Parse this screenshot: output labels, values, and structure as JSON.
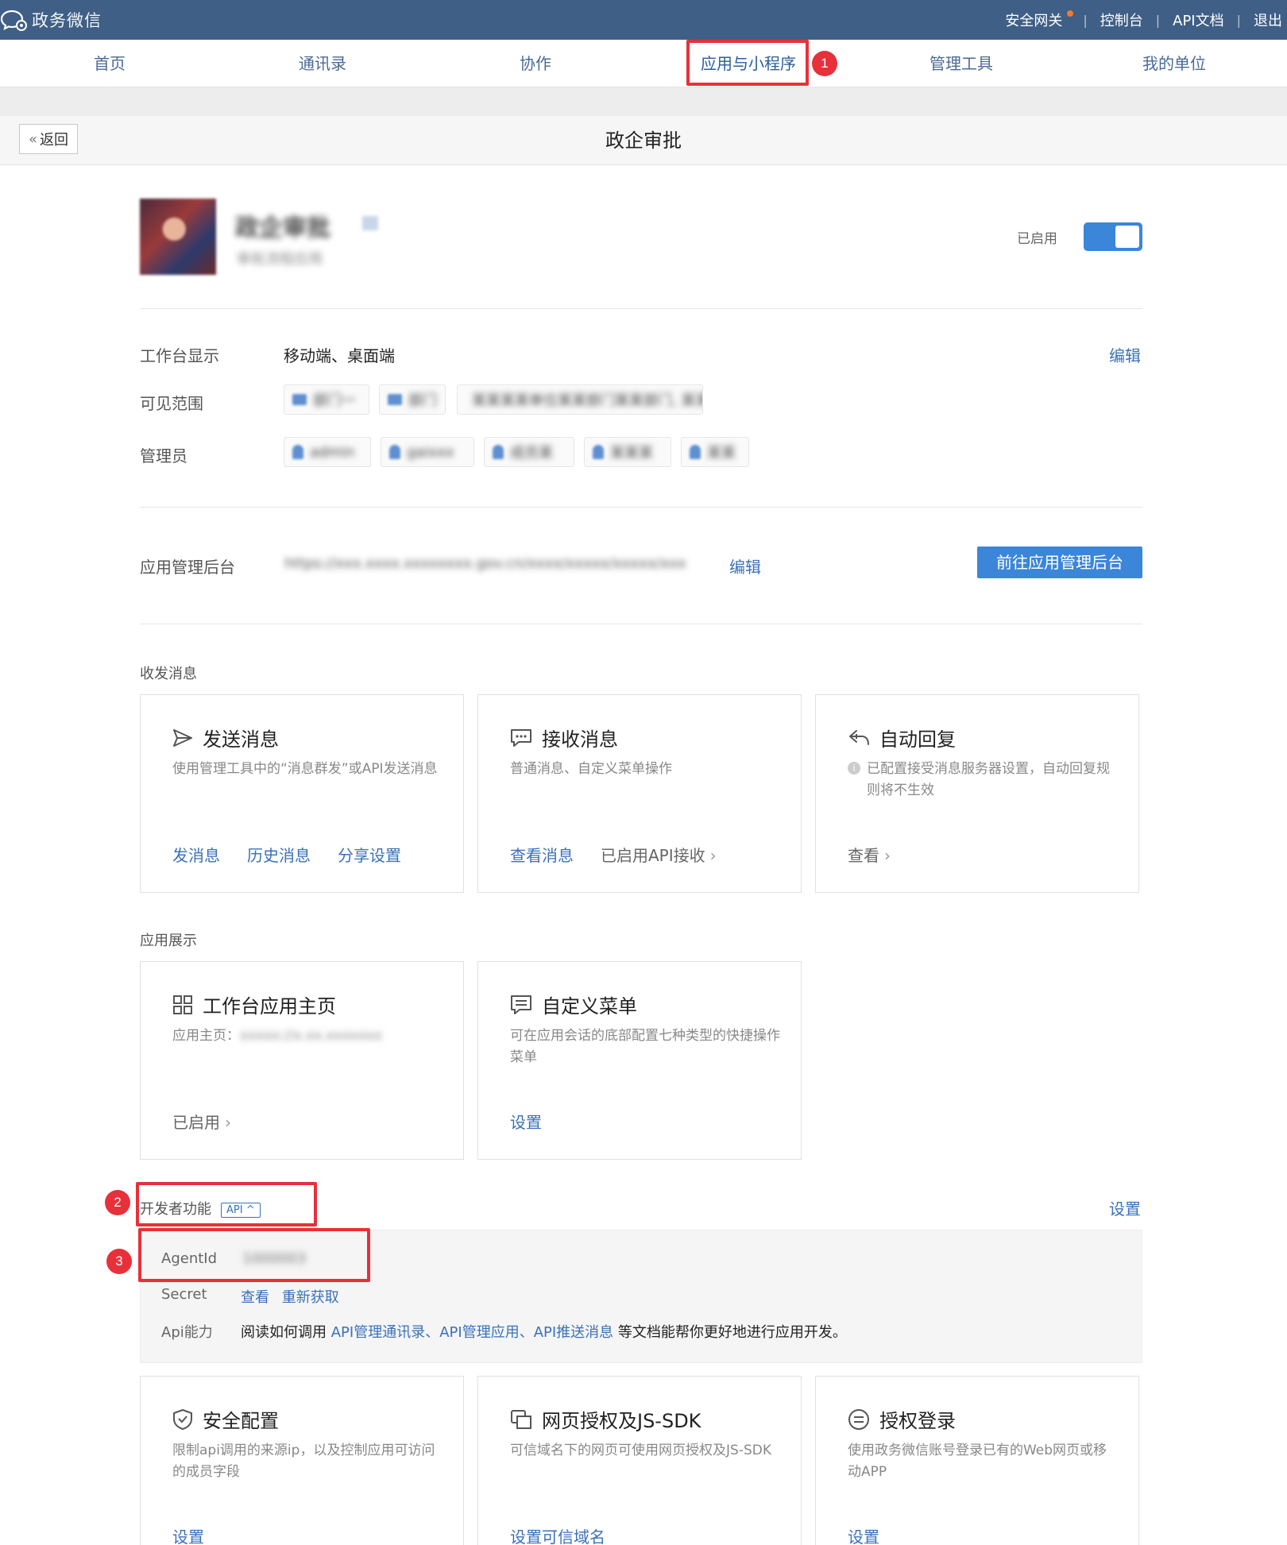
{
  "topbar": {
    "logo_text": "政务微信",
    "links": [
      "安全网关",
      "控制台",
      "API文档",
      "退出"
    ]
  },
  "nav": {
    "items": [
      "首页",
      "通讯录",
      "协作",
      "应用与小程序",
      "管理工具",
      "我的单位"
    ],
    "active": "应用与小程序"
  },
  "badges": [
    "1",
    "2",
    "3"
  ],
  "titlebar": {
    "back_label": "返回",
    "title": "政企审批"
  },
  "app": {
    "name": "政企审批",
    "subtitle": "审批流程应用",
    "status_label": "已启用"
  },
  "info": {
    "workbench_label": "工作台显示",
    "workbench_value": "移动端、桌面端",
    "workbench_edit": "编辑",
    "scope_label": "可见范围",
    "scope_items": [
      "部门一",
      "部门",
      "某某某某单位某某部门某某部门, 某某"
    ],
    "admin_label": "管理员",
    "admin_items": [
      "admin",
      "gaixxx",
      "成员某",
      "某某某",
      "某某"
    ],
    "backend_label": "应用管理后台",
    "backend_url": "https://xxx.xxxx.xxxxxxxx.gov.cn/xxxx/xxxxx/xxxxx/xxx",
    "backend_edit": "编辑",
    "backend_button": "前往应用管理后台"
  },
  "messaging": {
    "section_title": "收发消息",
    "send": {
      "title": "发送消息",
      "desc": "使用管理工具中的“消息群发”或API发送消息",
      "links": [
        "发消息",
        "历史消息",
        "分享设置"
      ]
    },
    "receive": {
      "title": "接收消息",
      "desc": "普通消息、自定义菜单操作",
      "link": "查看消息",
      "status": "已启用API接收"
    },
    "auto": {
      "title": "自动回复",
      "desc": "已配置接受消息服务器设置，自动回复规则将不生效",
      "link": "查看"
    }
  },
  "display": {
    "section_title": "应用展示",
    "home": {
      "title": "工作台应用主页",
      "desc_label": "应用主页：",
      "desc_value": "xxxxx://x.xx.xxxxxxx",
      "status": "已启用"
    },
    "menu": {
      "title": "自定义菜单",
      "desc": "可在应用会话的底部配置七种类型的快捷操作菜单",
      "link": "设置"
    }
  },
  "developer": {
    "section_title": "开发者功能",
    "api_tag": "API ^",
    "settings_link": "设置",
    "agentid_label": "AgentId",
    "agentid_value": "1000003",
    "secret_label": "Secret",
    "secret_view": "查看",
    "secret_refresh": "重新获取",
    "api_label": "Api能力",
    "api_prefix": "阅读如何调用",
    "api_links": [
      "API管理通讯录",
      "、",
      "API管理应用",
      "、",
      "API推送消息"
    ],
    "api_suffix": "等文档能帮你更好地进行应用开发。"
  },
  "security": {
    "sec": {
      "title": "安全配置",
      "desc": "限制api调用的来源ip，以及控制应用可访问的成员字段",
      "link": "设置"
    },
    "jssdk": {
      "title": "网页授权及JS-SDK",
      "desc": "可信域名下的网页可使用网页授权及JS-SDK",
      "link": "设置可信域名"
    },
    "login": {
      "title": "授权登录",
      "desc": "使用政务微信账号登录已有的Web网页或移动APP",
      "link": "设置"
    }
  },
  "colors": {
    "topbar": "#3f5f86",
    "accent": "#3b86d8",
    "link": "#3a71b8",
    "highlight": "#e8303a"
  }
}
